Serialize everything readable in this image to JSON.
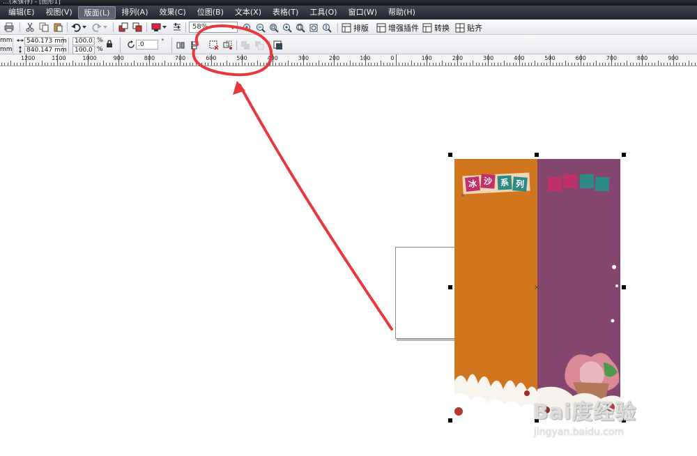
{
  "window": {
    "title": "…(未保存) - [图形1]"
  },
  "menu": {
    "items": [
      {
        "label": "编辑(E)",
        "active": false
      },
      {
        "label": "视图(V)",
        "active": false
      },
      {
        "label": "版面(L)",
        "active": true
      },
      {
        "label": "排列(A)",
        "active": false
      },
      {
        "label": "效果(C)",
        "active": false
      },
      {
        "label": "位图(B)",
        "active": false
      },
      {
        "label": "文本(X)",
        "active": false
      },
      {
        "label": "表格(T)",
        "active": false
      },
      {
        "label": "工具(O)",
        "active": false
      },
      {
        "label": "窗口(W)",
        "active": false
      },
      {
        "label": "帮助(H)",
        "active": false
      }
    ]
  },
  "toolbar": {
    "zoom_value": "58%",
    "plugins": [
      "排版",
      "增强插件",
      "转换",
      "贴齐"
    ]
  },
  "property_bar": {
    "pos_x_unit": "mm",
    "pos_y_unit": "mm",
    "width": "540.173 mm",
    "height": "840.147 mm",
    "scale_x": "100.0",
    "scale_y": "100.0",
    "percent": "%",
    "rotation": ".0",
    "degree": "°"
  },
  "ruler": {
    "labels": [
      "1200",
      "1100",
      "1000",
      "900",
      "800",
      "700",
      "600",
      "500",
      "400",
      "300",
      "200",
      "100",
      "0",
      "100",
      "200",
      "300",
      "400",
      "500",
      "600",
      "700",
      "800",
      "900"
    ]
  },
  "design": {
    "title_chars": [
      "冰",
      "沙",
      "系",
      "列"
    ],
    "orange": "#d2751f",
    "purple": "#84466e",
    "tile_colors": [
      "#c0306a",
      "#2f8a86",
      "#2f8a86",
      "#c0306a"
    ]
  },
  "annotation_color": "#e8383d",
  "watermark": {
    "logo": "Bai度经验",
    "url": "jingyan.baidu.com"
  }
}
